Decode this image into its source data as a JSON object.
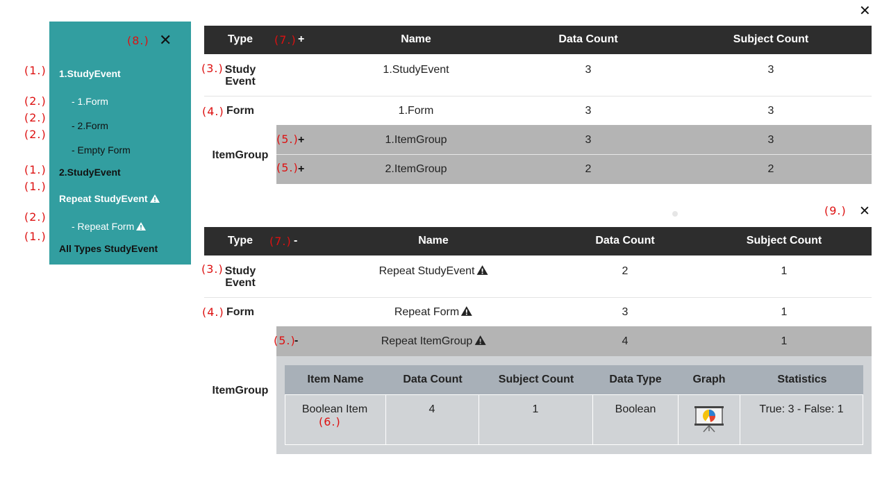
{
  "annotations": {
    "n1": "(1.)",
    "n2": "(2.)",
    "n3": "(3.)",
    "n4": "(4.)",
    "n5": "(5.)",
    "n6": "(6.)",
    "n7": "(7.)",
    "n8": "(8.)",
    "n9": "(9.)"
  },
  "close_glyph": "✕",
  "sidebar": {
    "close_glyph": "✕",
    "items": [
      {
        "label": "1.StudyEvent"
      },
      {
        "label": "- 1.Form"
      },
      {
        "label": "- 2.Form"
      },
      {
        "label": "- Empty Form"
      },
      {
        "label": "2.StudyEvent"
      },
      {
        "label": "Repeat StudyEvent"
      },
      {
        "label": "- Repeat Form"
      },
      {
        "label": "All Types StudyEvent"
      }
    ]
  },
  "table_headers": {
    "type": "Type",
    "name": "Name",
    "data_count": "Data Count",
    "subject_count": "Subject Count"
  },
  "table1": {
    "toggle": "+",
    "rows": {
      "study_event": {
        "type_line1": "Study",
        "type_line2": "Event",
        "name": "1.StudyEvent",
        "data_count": "3",
        "subject_count": "3"
      },
      "form": {
        "type": "Form",
        "name": "1.Form",
        "data_count": "3",
        "subject_count": "3"
      },
      "item_group_type": "ItemGroup",
      "item_groups": [
        {
          "toggle": "+",
          "name": "1.ItemGroup",
          "data_count": "3",
          "subject_count": "3"
        },
        {
          "toggle": "+",
          "name": "2.ItemGroup",
          "data_count": "2",
          "subject_count": "2"
        }
      ]
    }
  },
  "table2": {
    "toggle": "-",
    "rows": {
      "study_event": {
        "type_line1": "Study",
        "type_line2": "Event",
        "name": "Repeat StudyEvent",
        "data_count": "2",
        "subject_count": "1"
      },
      "form": {
        "type": "Form",
        "name": "Repeat Form",
        "data_count": "3",
        "subject_count": "1"
      },
      "item_group_type": "ItemGroup",
      "item_group": {
        "toggle": "-",
        "name": "Repeat ItemGroup",
        "data_count": "4",
        "subject_count": "1"
      }
    },
    "items_table": {
      "headers": {
        "item_name": "Item Name",
        "data_count": "Data Count",
        "subject_count": "Subject Count",
        "data_type": "Data Type",
        "graph": "Graph",
        "statistics": "Statistics"
      },
      "rows": [
        {
          "item_name": "Boolean Item",
          "data_count": "4",
          "subject_count": "1",
          "data_type": "Boolean",
          "graph": "chart-board-icon",
          "statistics": "True: 3 - False: 1"
        }
      ]
    }
  },
  "colors": {
    "sidebar": "#329ea0",
    "header": "#2d2d2d",
    "grey_row": "#b4b4b4",
    "annotation": "#dd1111"
  }
}
